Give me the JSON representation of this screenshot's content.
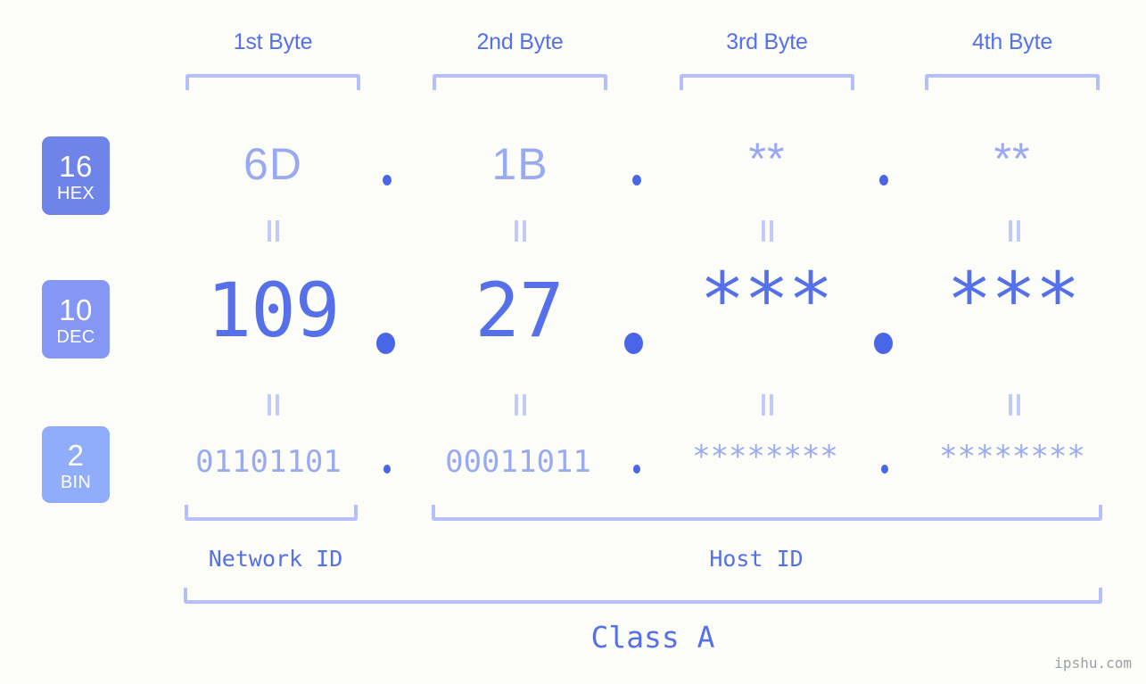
{
  "meta": {
    "background_color": "#fcfdf9",
    "accent_dark": "#5570e8",
    "accent_light": "#9aaaf2",
    "bracket_color": "#b6bffb",
    "dot_color": "#4a66e8"
  },
  "byte_headers": [
    {
      "label": "1st Byte"
    },
    {
      "label": "2nd Byte"
    },
    {
      "label": "3rd Byte"
    },
    {
      "label": "4th Byte"
    }
  ],
  "radix_rows": [
    {
      "badge": {
        "base": "16",
        "name": "HEX",
        "color": "#6f84e8"
      },
      "values": [
        "6D",
        "1B",
        "**",
        "**"
      ],
      "separator": "."
    },
    {
      "badge": {
        "base": "10",
        "name": "DEC",
        "color": "#8497f4"
      },
      "values": [
        "109",
        "27",
        "***",
        "***"
      ],
      "separator": "."
    },
    {
      "badge": {
        "base": "2",
        "name": "BIN",
        "color": "#8fadfb"
      },
      "values": [
        "01101101",
        "00011011",
        "********",
        "********"
      ],
      "separator": "."
    }
  ],
  "equality_symbol": "=",
  "segments": [
    {
      "label": "Network ID"
    },
    {
      "label": "Host ID"
    }
  ],
  "class_label": "Class A",
  "watermark": "ipshu.com"
}
